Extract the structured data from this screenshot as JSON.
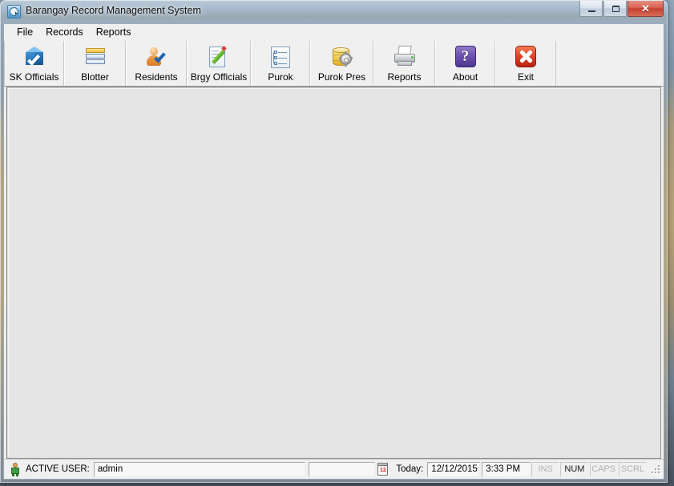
{
  "window": {
    "title": "Barangay Record Management System",
    "app_icon": "clock-icon",
    "controls": {
      "minimize": "minimize-icon",
      "maximize": "maximize-icon",
      "close": "✕"
    }
  },
  "menubar": {
    "items": [
      {
        "label": "File"
      },
      {
        "label": "Records"
      },
      {
        "label": "Reports"
      }
    ]
  },
  "toolbar": {
    "buttons": [
      {
        "label": "SK Officials",
        "icon": "blue-cube-check-icon"
      },
      {
        "label": "Blotter",
        "icon": "stacked-rows-icon"
      },
      {
        "label": "Residents",
        "icon": "person-check-icon"
      },
      {
        "label": "Brgy Officials",
        "icon": "document-pencil-icon"
      },
      {
        "label": "Purok",
        "icon": "document-tree-icon"
      },
      {
        "label": "Purok Pres",
        "icon": "database-gear-icon"
      },
      {
        "label": "Reports",
        "icon": "printer-icon"
      },
      {
        "label": "About",
        "icon": "question-mark-icon"
      },
      {
        "label": "Exit",
        "icon": "red-x-icon"
      }
    ]
  },
  "statusbar": {
    "user_icon": "user-icon",
    "active_user_label": "ACTIVE USER:",
    "active_user_value": "admin",
    "spacer_value": "",
    "calendar_icon": "calendar-icon",
    "calendar_day": "12",
    "today_label": "Today:",
    "date_value": "12/12/2015",
    "time_value": "3:33 PM",
    "indicators": [
      {
        "label": "INS",
        "active": false
      },
      {
        "label": "NUM",
        "active": true
      },
      {
        "label": "CAPS",
        "active": false
      },
      {
        "label": "SCRL",
        "active": false
      }
    ],
    "grip": "resize-grip-icon"
  },
  "colors": {
    "toolbar_bg": "#f0f0f0",
    "workarea_bg": "#e4e4e4",
    "close_button": "#c4402f",
    "accent_blue": "#1f66a8"
  }
}
